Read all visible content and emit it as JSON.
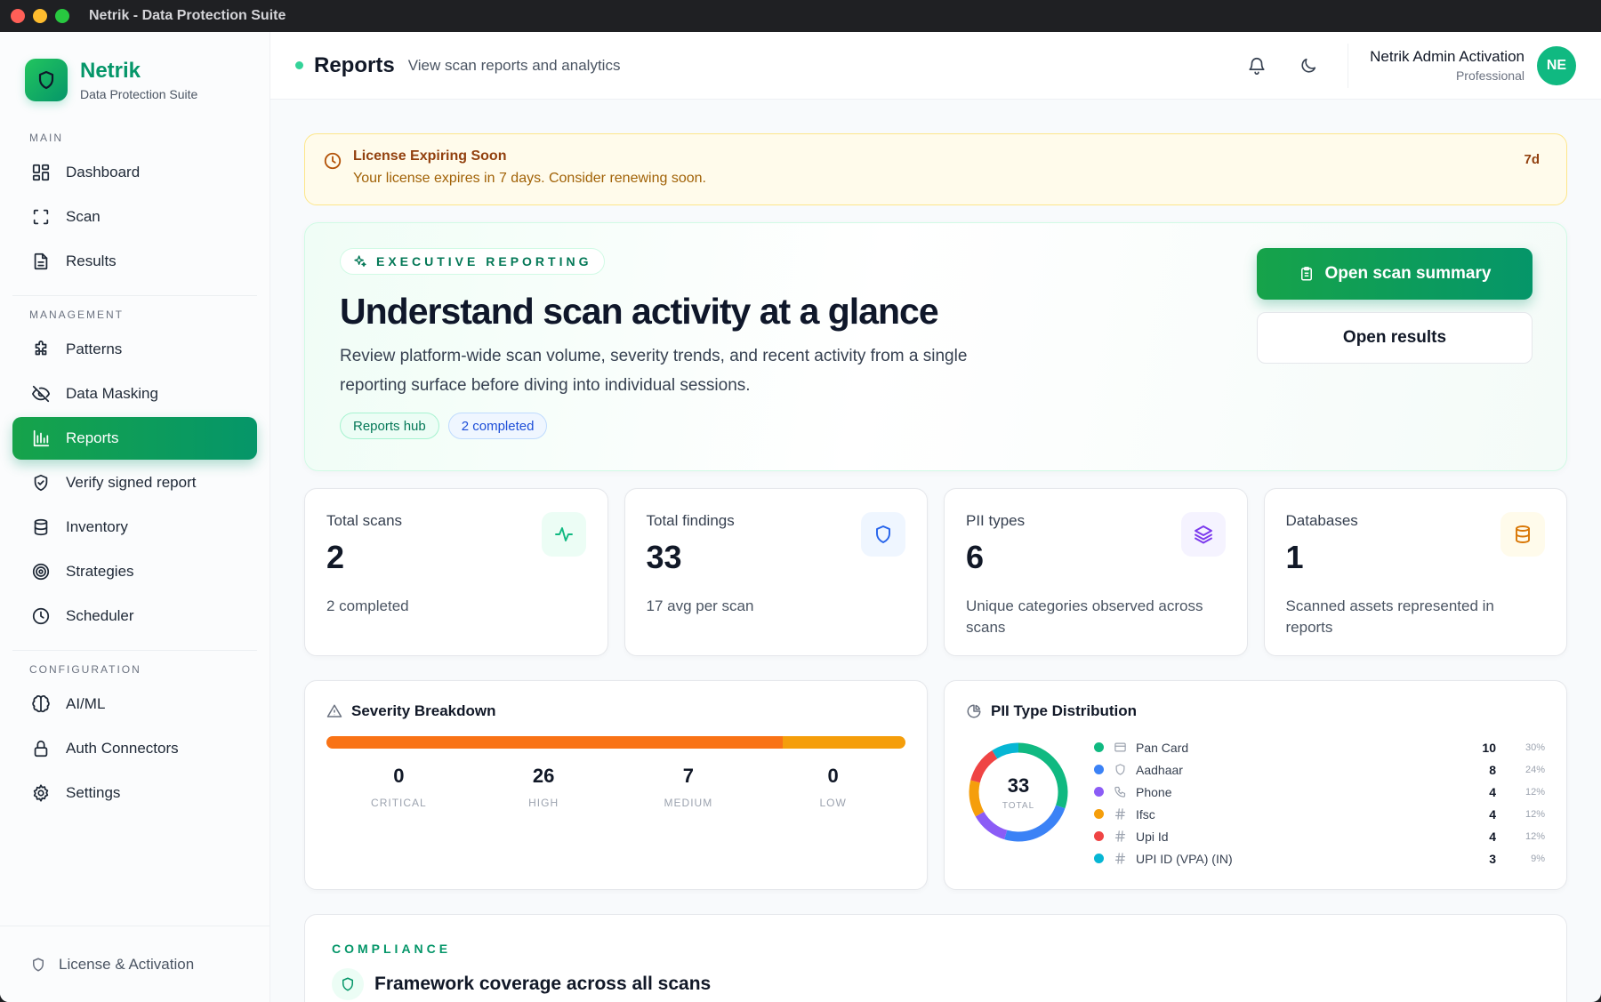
{
  "window": {
    "title": "Netrik - Data Protection Suite"
  },
  "brand": {
    "name": "Netrik",
    "subtitle": "Data Protection Suite"
  },
  "sidebar": {
    "sections": [
      {
        "label": "MAIN",
        "items": [
          {
            "label": "Dashboard",
            "icon": "dashboard-icon"
          },
          {
            "label": "Scan",
            "icon": "scan-icon"
          },
          {
            "label": "Results",
            "icon": "document-icon"
          }
        ]
      },
      {
        "label": "MANAGEMENT",
        "items": [
          {
            "label": "Patterns",
            "icon": "puzzle-icon"
          },
          {
            "label": "Data Masking",
            "icon": "eye-off-icon"
          },
          {
            "label": "Reports",
            "icon": "bar-chart-icon",
            "active": true
          },
          {
            "label": "Verify signed report",
            "icon": "shield-check-icon"
          },
          {
            "label": "Inventory",
            "icon": "database-icon"
          },
          {
            "label": "Strategies",
            "icon": "target-icon"
          },
          {
            "label": "Scheduler",
            "icon": "clock-icon"
          }
        ]
      },
      {
        "label": "CONFIGURATION",
        "items": [
          {
            "label": "AI/ML",
            "icon": "brain-icon"
          },
          {
            "label": "Auth Connectors",
            "icon": "lock-icon"
          },
          {
            "label": "Settings",
            "icon": "gear-icon"
          }
        ]
      }
    ],
    "footer": "License & Activation"
  },
  "header": {
    "title": "Reports",
    "subtitle": "View scan reports and analytics",
    "user_name": "Netrik Admin Activation",
    "user_plan": "Professional",
    "avatar_initials": "NE"
  },
  "alert": {
    "title": "License Expiring Soon",
    "message": "Your license expires in 7 days. Consider renewing soon.",
    "badge": "7d"
  },
  "hero": {
    "eyebrow": "EXECUTIVE REPORTING",
    "title": "Understand scan activity at a glance",
    "description": "Review platform-wide scan volume, severity trends, and recent activity from a single reporting surface before diving into individual sessions.",
    "tags": [
      "Reports hub",
      "2 completed"
    ],
    "primary_button": "Open scan summary",
    "secondary_button": "Open results"
  },
  "stats": [
    {
      "label": "Total scans",
      "value": "2",
      "note": "2 completed",
      "icon": "activity-icon",
      "color": "#10b981",
      "bg": "#ecfdf5"
    },
    {
      "label": "Total findings",
      "value": "33",
      "note": "17 avg per scan",
      "icon": "shield-icon",
      "color": "#2563eb",
      "bg": "#eff6ff"
    },
    {
      "label": "PII types",
      "value": "6",
      "note": "Unique categories observed across scans",
      "icon": "layers-icon",
      "color": "#7c3aed",
      "bg": "#f5f3ff"
    },
    {
      "label": "Databases",
      "value": "1",
      "note": "Scanned assets represented in reports",
      "icon": "database-icon",
      "color": "#d97706",
      "bg": "#fffbeb"
    }
  ],
  "severity": {
    "title": "Severity Breakdown",
    "levels": [
      {
        "label": "CRITICAL",
        "value": 0,
        "color": "#dc2626"
      },
      {
        "label": "HIGH",
        "value": 26,
        "color": "#f97316"
      },
      {
        "label": "MEDIUM",
        "value": 7,
        "color": "#f59e0b"
      },
      {
        "label": "LOW",
        "value": 0,
        "color": "#3b82f6"
      }
    ]
  },
  "pii_distribution": {
    "title": "PII Type Distribution",
    "total": "33",
    "total_label": "TOTAL",
    "items": [
      {
        "label": "Pan Card",
        "count": 10,
        "pct": "30%",
        "color": "#10b981",
        "icon": "card-icon"
      },
      {
        "label": "Aadhaar",
        "count": 8,
        "pct": "24%",
        "color": "#3b82f6",
        "icon": "shield-icon"
      },
      {
        "label": "Phone",
        "count": 4,
        "pct": "12%",
        "color": "#8b5cf6",
        "icon": "phone-icon"
      },
      {
        "label": "Ifsc",
        "count": 4,
        "pct": "12%",
        "color": "#f59e0b",
        "icon": "hash-icon"
      },
      {
        "label": "Upi Id",
        "count": 4,
        "pct": "12%",
        "color": "#ef4444",
        "icon": "hash-icon"
      },
      {
        "label": "UPI ID (VPA) (IN)",
        "count": 3,
        "pct": "9%",
        "color": "#06b6d4",
        "icon": "hash-icon"
      }
    ]
  },
  "compliance": {
    "eyebrow": "COMPLIANCE",
    "title": "Framework coverage across all scans"
  }
}
